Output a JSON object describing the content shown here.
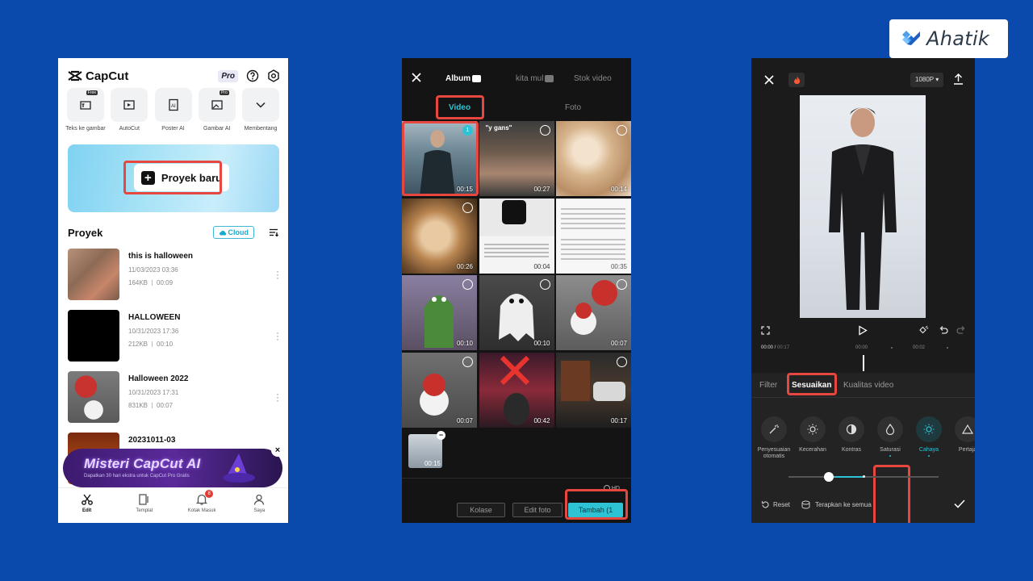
{
  "brand": {
    "name": "Ahatik"
  },
  "phone1": {
    "app_name": "CapCut",
    "pro_badge": "Pro",
    "tools": [
      {
        "label": "Teks ke gambar",
        "tag": "Free"
      },
      {
        "label": "AutoCut",
        "tag": ""
      },
      {
        "label": "Poster AI",
        "tag": ""
      },
      {
        "label": "Gambar AI",
        "tag": "Pro"
      },
      {
        "label": "Membentang",
        "tag": ""
      }
    ],
    "new_project_label": "Proyek baru",
    "projects_title": "Proyek",
    "cloud_label": "Cloud",
    "projects": [
      {
        "name": "this is halloween",
        "date": "11/03/2023 03:36",
        "size": "164KB",
        "duration": "00:09"
      },
      {
        "name": "HALLOWEEN",
        "date": "10/31/2023 17:36",
        "size": "212KB",
        "duration": "00:10"
      },
      {
        "name": "Halloween 2022",
        "date": "10/31/2023 17:31",
        "size": "831KB",
        "duration": "00:07"
      },
      {
        "name": "20231011-03",
        "date": "",
        "size": "",
        "duration": ""
      }
    ],
    "promo": {
      "title": "Misteri CapCut AI",
      "subtitle": "Dapatkan 30 hari ekstra untuk CapCut Pro Gratis"
    },
    "nav": [
      {
        "label": "Edit",
        "icon": "scissors-icon",
        "active": true
      },
      {
        "label": "Templat",
        "icon": "template-icon",
        "active": false
      },
      {
        "label": "Kotak Masuk",
        "icon": "bell-icon",
        "active": false,
        "badge": "8"
      },
      {
        "label": "Saya",
        "icon": "user-icon",
        "active": false
      }
    ]
  },
  "phone2": {
    "tabs": [
      "Album",
      "kita mul",
      "Stok video"
    ],
    "subtabs": [
      "Video",
      "Foto"
    ],
    "grid": [
      {
        "duration": "00:15",
        "selected": true,
        "index": "1"
      },
      {
        "duration": "00:27",
        "caption": "\"y gans\""
      },
      {
        "duration": "00:14"
      },
      {
        "duration": "00:26"
      },
      {
        "duration": "00:04"
      },
      {
        "duration": "00:35"
      },
      {
        "duration": "00:10"
      },
      {
        "duration": "00:10"
      },
      {
        "duration": "00:07"
      },
      {
        "duration": "00:07"
      },
      {
        "duration": "00:42"
      },
      {
        "duration": "00:17"
      }
    ],
    "tray_duration": "00:15",
    "hd_label": "HD",
    "buttons": {
      "collage": "Kolase",
      "edit_photo": "Edit foto",
      "add": "Tambah (1"
    }
  },
  "phone3": {
    "resolution": "1080P",
    "timeline": {
      "current": "00:00",
      "total": "00:17",
      "marks": [
        "00:00",
        "00:02"
      ]
    },
    "tabs": [
      "Filter",
      "Sesuaikan",
      "Kualitas video"
    ],
    "adjustments": [
      {
        "label": "Penyesuaian otomatis",
        "icon": "magic-wand-icon"
      },
      {
        "label": "Kecerahan",
        "icon": "sun-icon"
      },
      {
        "label": "Kontras",
        "icon": "contrast-icon"
      },
      {
        "label": "Saturasi",
        "icon": "droplet-icon"
      },
      {
        "label": "Cahaya",
        "icon": "light-icon"
      },
      {
        "label": "Pertaja",
        "icon": "triangle-icon"
      }
    ],
    "reset_label": "Reset",
    "apply_all_label": "Terapkan ke semua"
  }
}
